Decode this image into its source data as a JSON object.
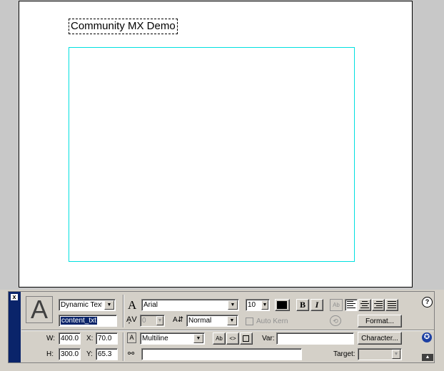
{
  "stage": {
    "title_text": "Community MX Demo"
  },
  "inspector": {
    "text_type": "Dynamic Text",
    "instance_name": "content_txt",
    "font": "Arial",
    "font_size": "10",
    "text_color": "#000000",
    "bold_label": "B",
    "italic_label": "I",
    "kerning_value": "0",
    "char_position": "Normal",
    "auto_kern_label": "Auto Kern",
    "format_button": "Format...",
    "character_button": "Character...",
    "w_label": "W:",
    "w_value": "400.0",
    "x_label": "X:",
    "x_value": "70.0",
    "h_label": "H:",
    "h_value": "300.0",
    "y_label": "Y:",
    "y_value": "65.3",
    "line_type": "Multiline",
    "var_label": "Var:",
    "var_value": "",
    "url_value": "",
    "target_label": "Target:",
    "target_value": "",
    "help_glyph": "?",
    "close_glyph": "x",
    "big_a_glyph": "A",
    "font_glyph": "A",
    "selectable_glyph": "Ab",
    "html_glyph": "<>",
    "collapse_glyph": "▲",
    "access_glyph": "✪"
  },
  "icons": {
    "kerning": "kerning-icon",
    "char_position": "character-position-icon",
    "line_type": "line-type-icon",
    "url_link": "url-link-icon",
    "rotate": "rotate-text-icon",
    "direction": "text-direction-icon"
  }
}
